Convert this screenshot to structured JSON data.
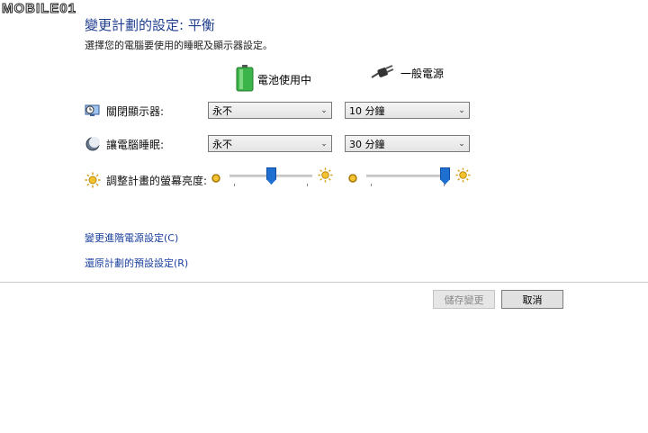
{
  "watermark": "MOBILE01",
  "header": {
    "title": "變更計劃的設定: 平衡",
    "subtitle": "選擇您的電腦要使用的睡眠及顯示器設定。"
  },
  "columns": {
    "battery": "電池使用中",
    "plugged": "一般電源"
  },
  "rows": {
    "display": {
      "label": "關閉顯示器:",
      "battery_value": "永不",
      "plugged_value": "10 分鐘"
    },
    "sleep": {
      "label": "讓電腦睡眠:",
      "battery_value": "永不",
      "plugged_value": "30 分鐘"
    },
    "brightness": {
      "label": "調整計畫的螢幕亮度:",
      "battery_level": 0.5,
      "plugged_level": 1.0
    }
  },
  "links": {
    "advanced": "變更進階電源設定(C)",
    "restore": "還原計劃的預設設定(R)"
  },
  "buttons": {
    "save": "儲存變更",
    "cancel": "取消"
  },
  "colors": {
    "accent": "#1f6fd1",
    "link": "#1a3f9c",
    "battery_green": "#3bb54a"
  }
}
